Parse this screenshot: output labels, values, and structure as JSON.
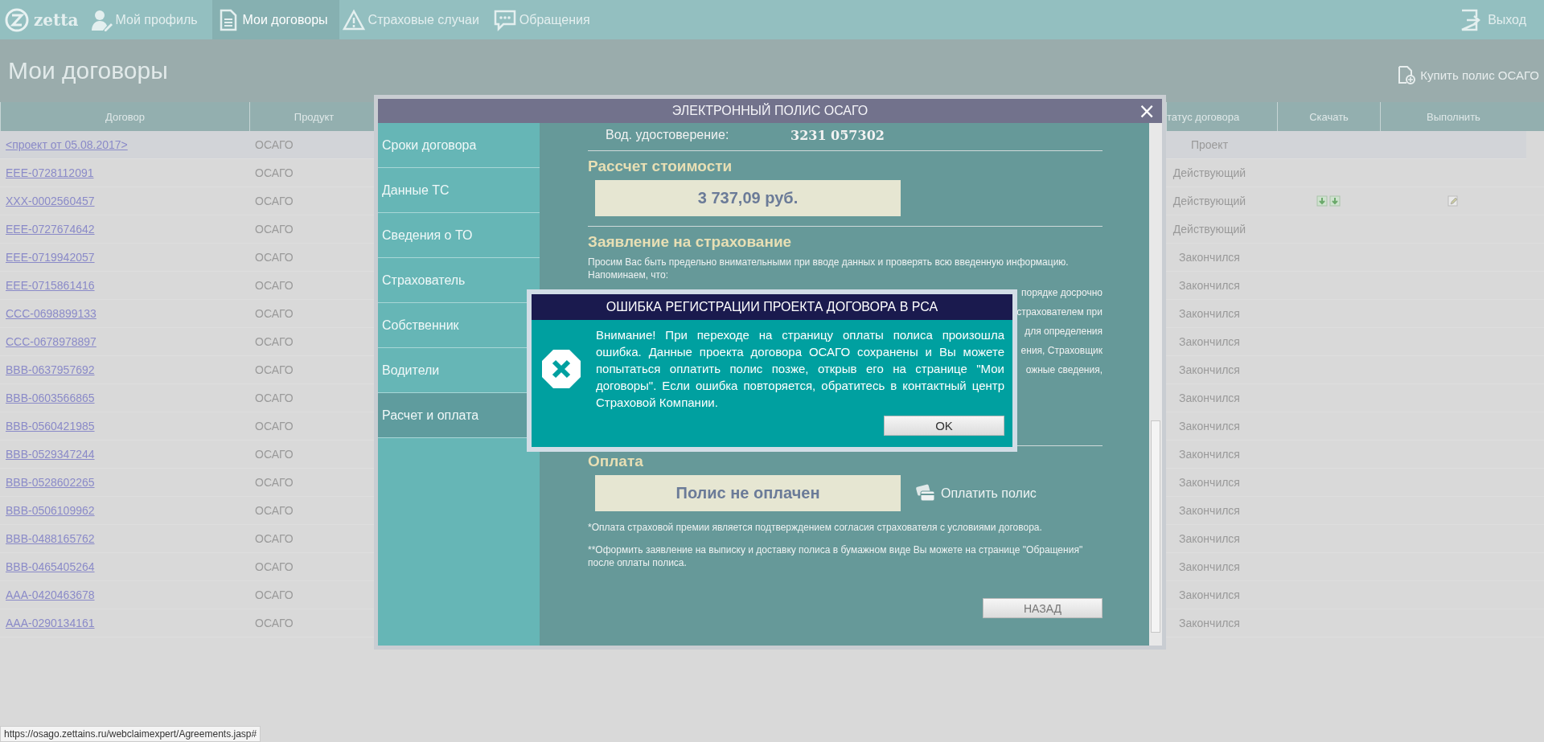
{
  "nav": {
    "logo": "zetta",
    "items": [
      {
        "label": "Мой профиль",
        "selected": false
      },
      {
        "label": "Мои договоры",
        "selected": true
      },
      {
        "label": "Страховые случаи",
        "selected": false
      },
      {
        "label": "Обращения",
        "selected": false
      }
    ],
    "exit": "Выход"
  },
  "page": {
    "title": "Мои договоры",
    "buy_link": "Купить полис ОСАГО"
  },
  "table": {
    "columns": [
      "Договор",
      "Продукт",
      "татус договора",
      "Скачать",
      "Выполнить"
    ],
    "rows": [
      {
        "contract": "<проект от 05.08.2017>",
        "product": "ОСАГО",
        "status": "Проект",
        "selected": true,
        "downloadable": false,
        "editable": false
      },
      {
        "contract": "ЕЕЕ-0728112091",
        "product": "ОСАГО",
        "status": "Действующий",
        "selected": false,
        "downloadable": false,
        "editable": false
      },
      {
        "contract": "XXX-0002560457",
        "product": "ОСАГО",
        "status": "Действующий",
        "selected": false,
        "downloadable": true,
        "editable": true
      },
      {
        "contract": "ЕЕЕ-0727674642",
        "product": "ОСАГО",
        "status": "Действующий",
        "selected": false,
        "downloadable": false,
        "editable": false
      },
      {
        "contract": "ЕЕЕ-0719942057",
        "product": "ОСАГО",
        "status": "Закончился",
        "selected": false,
        "downloadable": false,
        "editable": false
      },
      {
        "contract": "ЕЕЕ-0715861416",
        "product": "ОСАГО",
        "status": "Закончился",
        "selected": false,
        "downloadable": false,
        "editable": false
      },
      {
        "contract": "ССС-0698899133",
        "product": "ОСАГО",
        "status": "Закончился",
        "selected": false,
        "downloadable": false,
        "editable": false
      },
      {
        "contract": "ССС-0678978897",
        "product": "ОСАГО",
        "status": "Закончился",
        "selected": false,
        "downloadable": false,
        "editable": false
      },
      {
        "contract": "ВВВ-0637957692",
        "product": "ОСАГО",
        "status": "Закончился",
        "selected": false,
        "downloadable": false,
        "editable": false
      },
      {
        "contract": "ВВВ-0603566865",
        "product": "ОСАГО",
        "status": "Закончился",
        "selected": false,
        "downloadable": false,
        "editable": false
      },
      {
        "contract": "ВВВ-0560421985",
        "product": "ОСАГО",
        "status": "Закончился",
        "selected": false,
        "downloadable": false,
        "editable": false
      },
      {
        "contract": "ВВВ-0529347244",
        "product": "ОСАГО",
        "status": "Закончился",
        "selected": false,
        "downloadable": false,
        "editable": false
      },
      {
        "contract": "ВВВ-0528602265",
        "product": "ОСАГО",
        "status": "Закончился",
        "selected": false,
        "downloadable": false,
        "editable": false
      },
      {
        "contract": "ВВВ-0506109962",
        "product": "ОСАГО",
        "status": "Закончился",
        "selected": false,
        "downloadable": false,
        "editable": false
      },
      {
        "contract": "ВВВ-0488165762",
        "product": "ОСАГО",
        "status": "Закончился",
        "selected": false,
        "downloadable": false,
        "editable": false
      },
      {
        "contract": "ВВВ-0465405264",
        "product": "ОСАГО",
        "status": "Закончился",
        "selected": false,
        "downloadable": false,
        "editable": false
      },
      {
        "contract": "ААА-0420463678",
        "product": "ОСАГО",
        "status": "Закончился",
        "selected": false,
        "downloadable": false,
        "editable": false
      },
      {
        "contract": "ААА-0290134161",
        "product": "ОСАГО",
        "status": "Закончился",
        "selected": false,
        "downloadable": false,
        "editable": false
      }
    ]
  },
  "modal": {
    "title": "ЭЛЕКТРОННЫЙ ПОЛИС ОСАГО",
    "close": "×",
    "menu": [
      {
        "label": "Сроки договора",
        "selected": false
      },
      {
        "label": "Данные ТС",
        "selected": false
      },
      {
        "label": "Сведения о ТО",
        "selected": false
      },
      {
        "label": "Страхователь",
        "selected": false
      },
      {
        "label": "Собственник",
        "selected": false
      },
      {
        "label": "Водители",
        "selected": false
      },
      {
        "label": "Расчет и оплата",
        "selected": true
      }
    ],
    "license_label": "Вод. удостоверение:",
    "license_value": "3231 057302",
    "cost_heading": "Рассчет стоимости",
    "cost": "3 737,09 руб.",
    "statement_heading": "Заявление на страхование",
    "statement_text": "Просим Вас быть предельно внимательными при вводе данных и проверять всю введенную информацию.",
    "remind": "Напоминаем, что:",
    "fragments": [
      "порядке досрочно",
      "страхователем при",
      "для определения",
      "ения, Страховщик",
      "ожные сведения,"
    ],
    "payment_heading": "Оплата",
    "payment_status": "Полис не оплачен",
    "pay_link": "Оплатить полис",
    "notes": [
      "*Оплата страховой премии является подтверждением согласия страхователя с условиями договора.",
      "**Оформить заявление на выписку и доставку полиса в бумажном виде Вы можете на странице \"Обращения\" после оплаты полиса."
    ],
    "back": "НАЗАД"
  },
  "error": {
    "title": "ОШИБКА РЕГИСТРАЦИИ ПРОЕКТА ДОГОВОРА В РСА",
    "text": "Внимание! При переходе на страницу оплаты полиса произошла ошибка. Данные проекта договора ОСАГО сохранены и Вы можете попытаться оплатить полис позже, открыв его на странице \"Мои договоры\". Если ошибка повторяется, обратитесь в контактный центр Страховой Компании.",
    "ok": "OK"
  },
  "status_url": "https://osago.zettains.ru/webclaimexpert/Agreements.jasp#"
}
